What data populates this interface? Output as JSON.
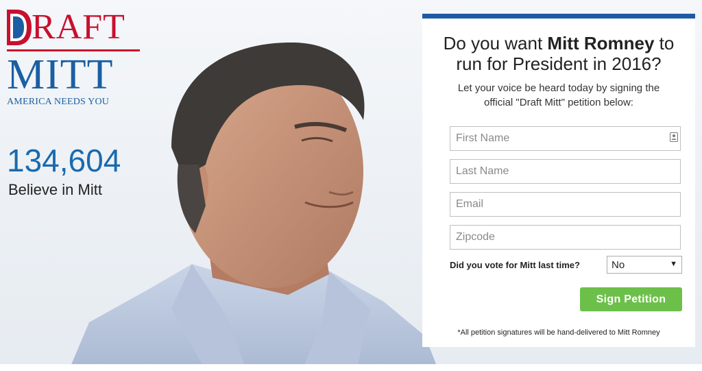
{
  "logo": {
    "draft_text": "RAFT",
    "mitt_text": "MITT",
    "tagline": "AMERICA NEEDS YOU"
  },
  "counter": {
    "value": "134,604",
    "label": "Believe in Mitt"
  },
  "panel": {
    "title_pre": "Do you want ",
    "title_name": "Mitt Romney",
    "title_post": " to run for President in 2016?",
    "subtitle": "Let your voice be heard today by signing the official \"Draft Mitt\" petition below:",
    "fields": {
      "first_name": "First Name",
      "last_name": "Last Name",
      "email": "Email",
      "zipcode": "Zipcode"
    },
    "vote_question": "Did you vote for Mitt last time?",
    "vote_selected": "No",
    "sign_button": "Sign Petition",
    "footnote": "*All petition signatures will be hand-delivered to Mitt Romney"
  },
  "colors": {
    "brand_red": "#c8102e",
    "brand_blue": "#1a5fa3",
    "panel_border": "#1c5aa6",
    "button_green": "#6cc04a"
  },
  "icons": {
    "logo_mark": "draft-d-logo-icon",
    "field_contact": "contact-card-icon",
    "select_arrow": "chevron-down-icon"
  }
}
